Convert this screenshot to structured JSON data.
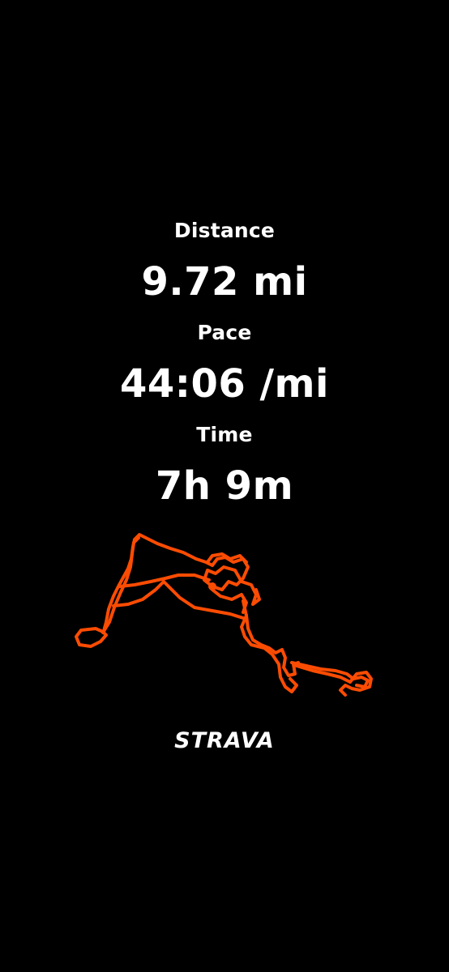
{
  "stats": {
    "distance": {
      "label": "Distance",
      "value": "9.72 mi"
    },
    "pace": {
      "label": "Pace",
      "value": "44:06 /mi"
    },
    "time": {
      "label": "Time",
      "value": "7h 9m"
    }
  },
  "route": {
    "icon": "route-map-trace",
    "color": "#fc4c02"
  },
  "brand": {
    "name": "STRAVA",
    "icon": "strava-logo"
  },
  "colors": {
    "background": "#000000",
    "text": "#ffffff",
    "accent": "#fc4c02"
  }
}
